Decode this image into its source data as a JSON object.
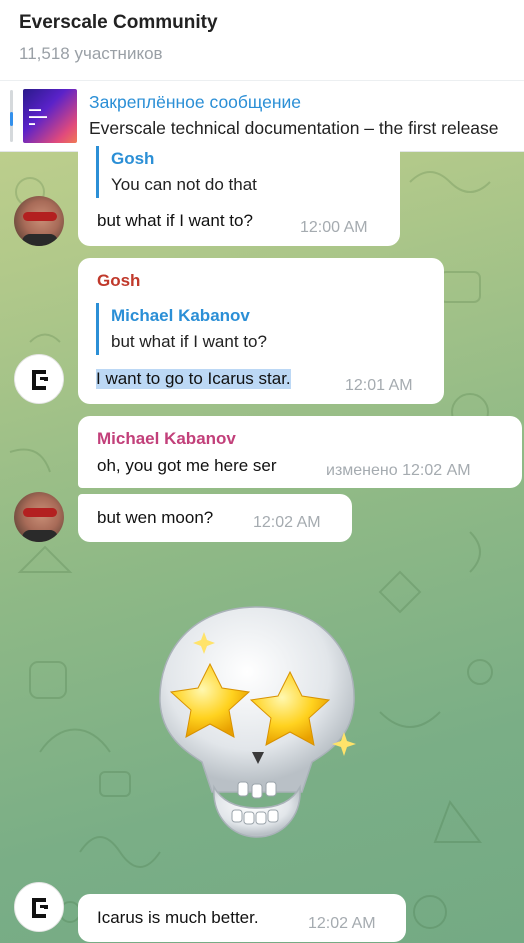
{
  "header": {
    "title": "Everscale Community",
    "subtitle": "11,518 участников"
  },
  "pinned": {
    "title": "Закреплённое сообщение",
    "text": "Everscale technical documentation – the first release"
  },
  "messages": [
    {
      "reply_name": "Gosh",
      "reply_text": "You can not do that",
      "text": "but what if I want to?",
      "time": "12:00 AM"
    },
    {
      "sender": "Gosh",
      "reply_name": "Michael Kabanov",
      "reply_text": "but what if I want to?",
      "text": "I want to go to Icarus star.",
      "time": "12:01 AM"
    },
    {
      "sender": "Michael Kabanov",
      "text": "oh, you got me here ser",
      "time": "изменено 12:02 AM"
    },
    {
      "text": "but wen moon?",
      "time": "12:02 AM"
    },
    {
      "text": "Icarus is much better.",
      "time": "12:02 AM"
    }
  ],
  "colors": {
    "gosh_name": "#c0392b",
    "michael_name": "#c2407a",
    "reply_accent": "#2b8fd6",
    "highlight": "#bcd8f5"
  },
  "icons": {
    "pinned_thumb": "document-thumbnail",
    "avatar_michael": "user-photo-avatar",
    "avatar_gosh": "gosh-logo-avatar",
    "sticker": "skull-star-eyes-sticker"
  }
}
